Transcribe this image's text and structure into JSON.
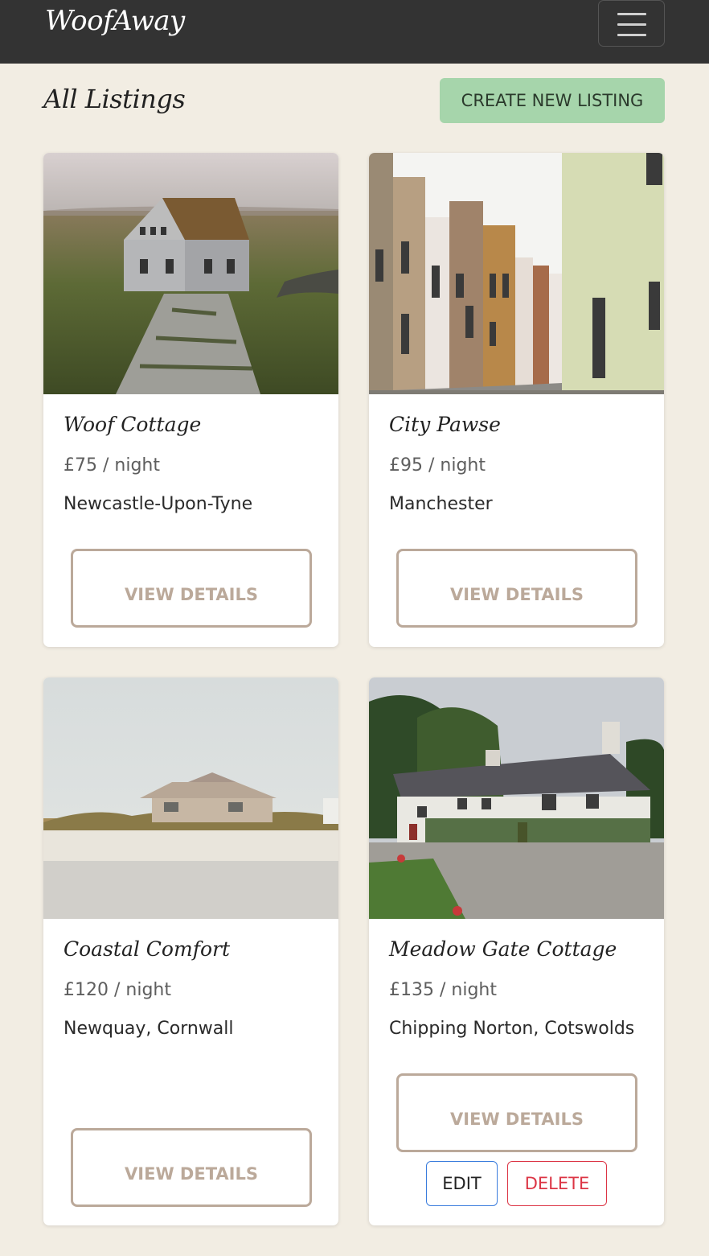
{
  "navbar": {
    "brand": "WoofAway",
    "menu_icon": "hamburger-menu-icon"
  },
  "header": {
    "title": "All Listings",
    "create_button": "CREATE NEW LISTING",
    "create_button_color": "#a6d5ab"
  },
  "listings": [
    {
      "title": "Woof Cottage",
      "price": "£75 / night",
      "location": "Newcastle-Upon-Tyne",
      "view_label": "VIEW DETAILS",
      "image": "turf-roof-house-photo"
    },
    {
      "title": "City Pawse",
      "price": "£95 / night",
      "location": "Manchester",
      "view_label": "VIEW DETAILS",
      "image": "city-street-photo"
    },
    {
      "title": "Coastal Comfort",
      "price": "£120 / night",
      "location": "Newquay, Cornwall",
      "view_label": "VIEW DETAILS",
      "image": "beach-house-photo"
    },
    {
      "title": "Meadow Gate Cottage",
      "price": "£135 / night",
      "location": "Chipping Norton, Cotswolds",
      "view_label": "VIEW DETAILS",
      "edit_label": "EDIT",
      "delete_label": "DELETE",
      "image": "white-cottage-photo"
    }
  ],
  "colors": {
    "navbar": "#333333",
    "background": "#f2ede3",
    "view_button": "#bba99a",
    "edit_border": "#3b7ddd",
    "delete": "#dc3545"
  }
}
